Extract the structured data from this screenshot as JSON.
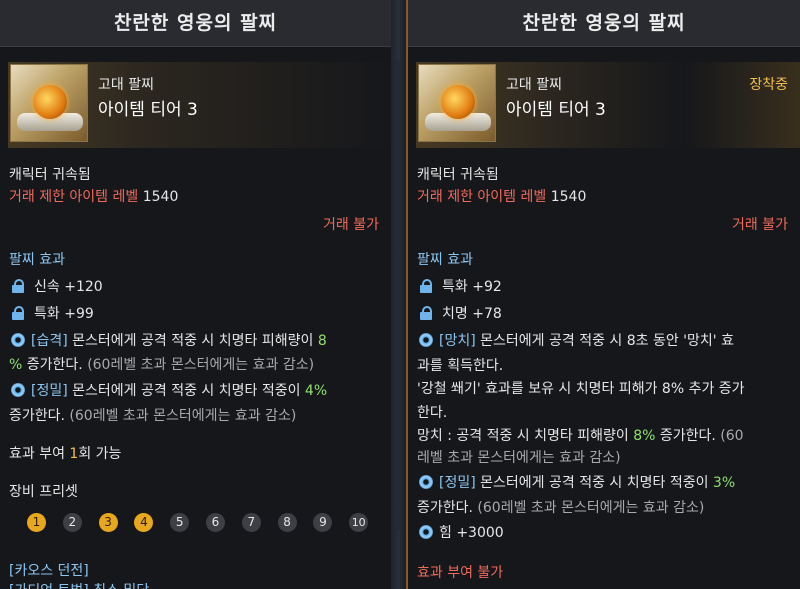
{
  "left": {
    "title": "찬란한 영웅의 팔찌",
    "grade": "고대 팔찌",
    "tier": "아이템 티어 3",
    "bound": "캐릭터 귀속됨",
    "trade_level_label": "거래 제한 아이템 레벨",
    "trade_level_value": "1540",
    "trade_status": "거래 불가",
    "effects_title": "팔찌 효과",
    "stats": [
      {
        "icon": "lock-icon",
        "label": "신속 +120"
      },
      {
        "icon": "lock-icon",
        "label": "특화 +99"
      }
    ],
    "effect1": {
      "tag": "[습격]",
      "text_a": " 몬스터에게 공격 적중 시 치명타 피해량이 ",
      "value": "8",
      "text_b": "%",
      "text_c": " 증가한다. ",
      "note": "(60레벨 초과 몬스터에게는 효과 감소)"
    },
    "effect2": {
      "tag": "[정밀]",
      "text_a": " 몬스터에게 공격 적중 시 치명타 적중이 ",
      "value": "4%",
      "text_c": "증가한다. ",
      "note": "(60레벨 초과 몬스터에게는 효과 감소)"
    },
    "grant_label": "효과 부여 ",
    "grant_count": "1",
    "grant_suffix": "회 가능",
    "preset_title": "장비 프리셋",
    "presets": [
      "1",
      "2",
      "3",
      "4",
      "5",
      "6",
      "7",
      "8",
      "9",
      "10"
    ],
    "presets_active": [
      1,
      3,
      4
    ],
    "link1": "[카오스 던전]",
    "link2": "[가디언 토벌] 최소 밀당"
  },
  "right": {
    "title": "찬란한 영웅의 팔찌",
    "grade": "고대 팔찌",
    "tier": "아이템 티어 3",
    "equipped": "장착중",
    "bound": "캐릭터 귀속됨",
    "trade_level_label": "거래 제한 아이템 레벨",
    "trade_level_value": "1540",
    "trade_status": "거래 불가",
    "effects_title": "팔찌 효과",
    "stats": [
      {
        "icon": "lock-icon",
        "label": "특화 +92"
      },
      {
        "icon": "lock-icon",
        "label": "치명 +78"
      }
    ],
    "effect1": {
      "tag": "[망치]",
      "line1": " 몬스터에게 공격 적중 시 8초 동안 '망치' 효",
      "line2": "과를 획득한다.",
      "line3": "'강철 쐐기' 효과를 보유 시 치명타 피해가 8% 추가 증가",
      "line4": "한다.",
      "line5_a": "망치 : 공격 적중 시 치명타 피해량이 ",
      "line5_value": "8%",
      "line5_b": " 증가한다. ",
      "line5_note": "(60",
      "line6_note": "레벨 초과 몬스터에게는 효과 감소)"
    },
    "effect2": {
      "tag": "[정밀]",
      "text_a": " 몬스터에게 공격 적중 시 치명타 적중이 ",
      "value": "3%",
      "text_c": "증가한다. ",
      "note": "(60레벨 초과 몬스터에게는 효과 감소)"
    },
    "power": "힘 +3000",
    "grant_disabled": "효과 부여 불가"
  },
  "colors": {
    "trade_red": "#f06a5a",
    "effect_blue": "#8cc6f0",
    "value_green": "#8ee06a",
    "active_gold": "#f2c04a",
    "equipped_border": "#8a5a22"
  }
}
